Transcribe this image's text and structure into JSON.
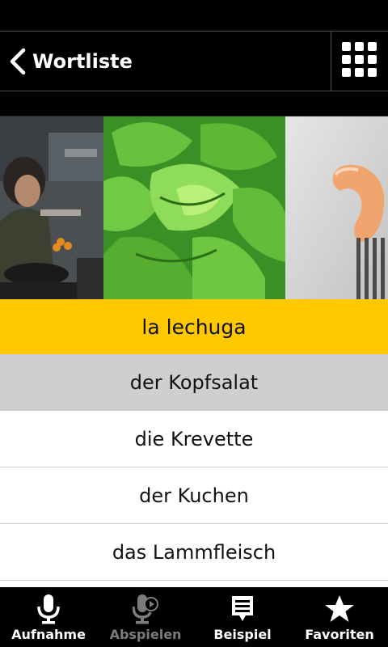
{
  "header": {
    "title": "Wortliste"
  },
  "gallery": {
    "images": [
      {
        "subject": "woman cooking"
      },
      {
        "subject": "lettuce"
      },
      {
        "subject": "shrimp on fork"
      }
    ]
  },
  "word_list": {
    "items": [
      {
        "label": "la lechuga",
        "state": "active"
      },
      {
        "label": "der Kopfsalat",
        "state": "selected"
      },
      {
        "label": "die Krevette",
        "state": "normal"
      },
      {
        "label": "der Kuchen",
        "state": "normal"
      },
      {
        "label": "das Lammfleisch",
        "state": "normal"
      }
    ]
  },
  "bottom_bar": {
    "tabs": [
      {
        "label": "Aufnahme",
        "icon": "microphone-icon",
        "enabled": true
      },
      {
        "label": "Abspielen",
        "icon": "playback-icon",
        "enabled": false
      },
      {
        "label": "Beispiel",
        "icon": "speech-bubble-icon",
        "enabled": true
      },
      {
        "label": "Favoriten",
        "icon": "star-icon",
        "enabled": true
      }
    ]
  },
  "colors": {
    "accent": "#ffc800",
    "selected": "#cfcfcf",
    "disabled_text": "#7c7c7c"
  }
}
